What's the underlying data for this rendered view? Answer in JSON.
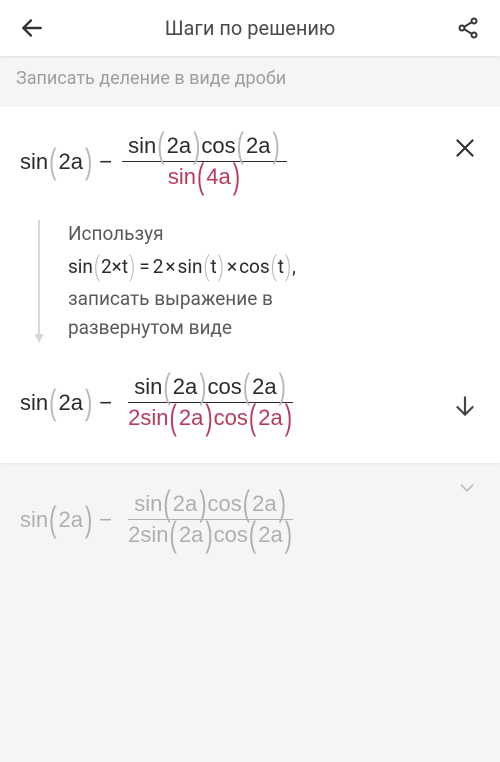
{
  "header": {
    "title": "Шаги по решению"
  },
  "subheader": "Записать деление в виде дроби",
  "step1": {
    "lhs_func": "sin",
    "lhs_arg": "2a",
    "minus": "−",
    "num_f1": "sin",
    "num_a1": "2a",
    "num_f2": "cos",
    "num_a2": "2a",
    "den_f": "sin",
    "den_a": "4a"
  },
  "hint": {
    "line1": "Используя",
    "formula_f1": "sin",
    "formula_a1": "2×t",
    "formula_eq": "=",
    "formula_c1": "2",
    "formula_times1": "×",
    "formula_f2": "sin",
    "formula_a2": "t",
    "formula_times2": "×",
    "formula_f3": "cos",
    "formula_a3": "t",
    "formula_comma": ",",
    "line2a": "записать выражение в",
    "line2b": "развернутом виде"
  },
  "step2": {
    "lhs_func": "sin",
    "lhs_arg": "2a",
    "minus": "−",
    "num_f1": "sin",
    "num_a1": "2a",
    "num_f2": "cos",
    "num_a2": "2a",
    "den_c": "2",
    "den_f1": "sin",
    "den_a1": "2a",
    "den_f2": "cos",
    "den_a2": "2a"
  },
  "faded": {
    "lhs_func": "sin",
    "lhs_arg": "2a",
    "minus": "−",
    "num_f1": "sin",
    "num_a1": "2a",
    "num_f2": "cos",
    "num_a2": "2a",
    "den_c": "2",
    "den_f1": "sin",
    "den_a1": "2a",
    "den_f2": "cos",
    "den_a2": "2a"
  }
}
